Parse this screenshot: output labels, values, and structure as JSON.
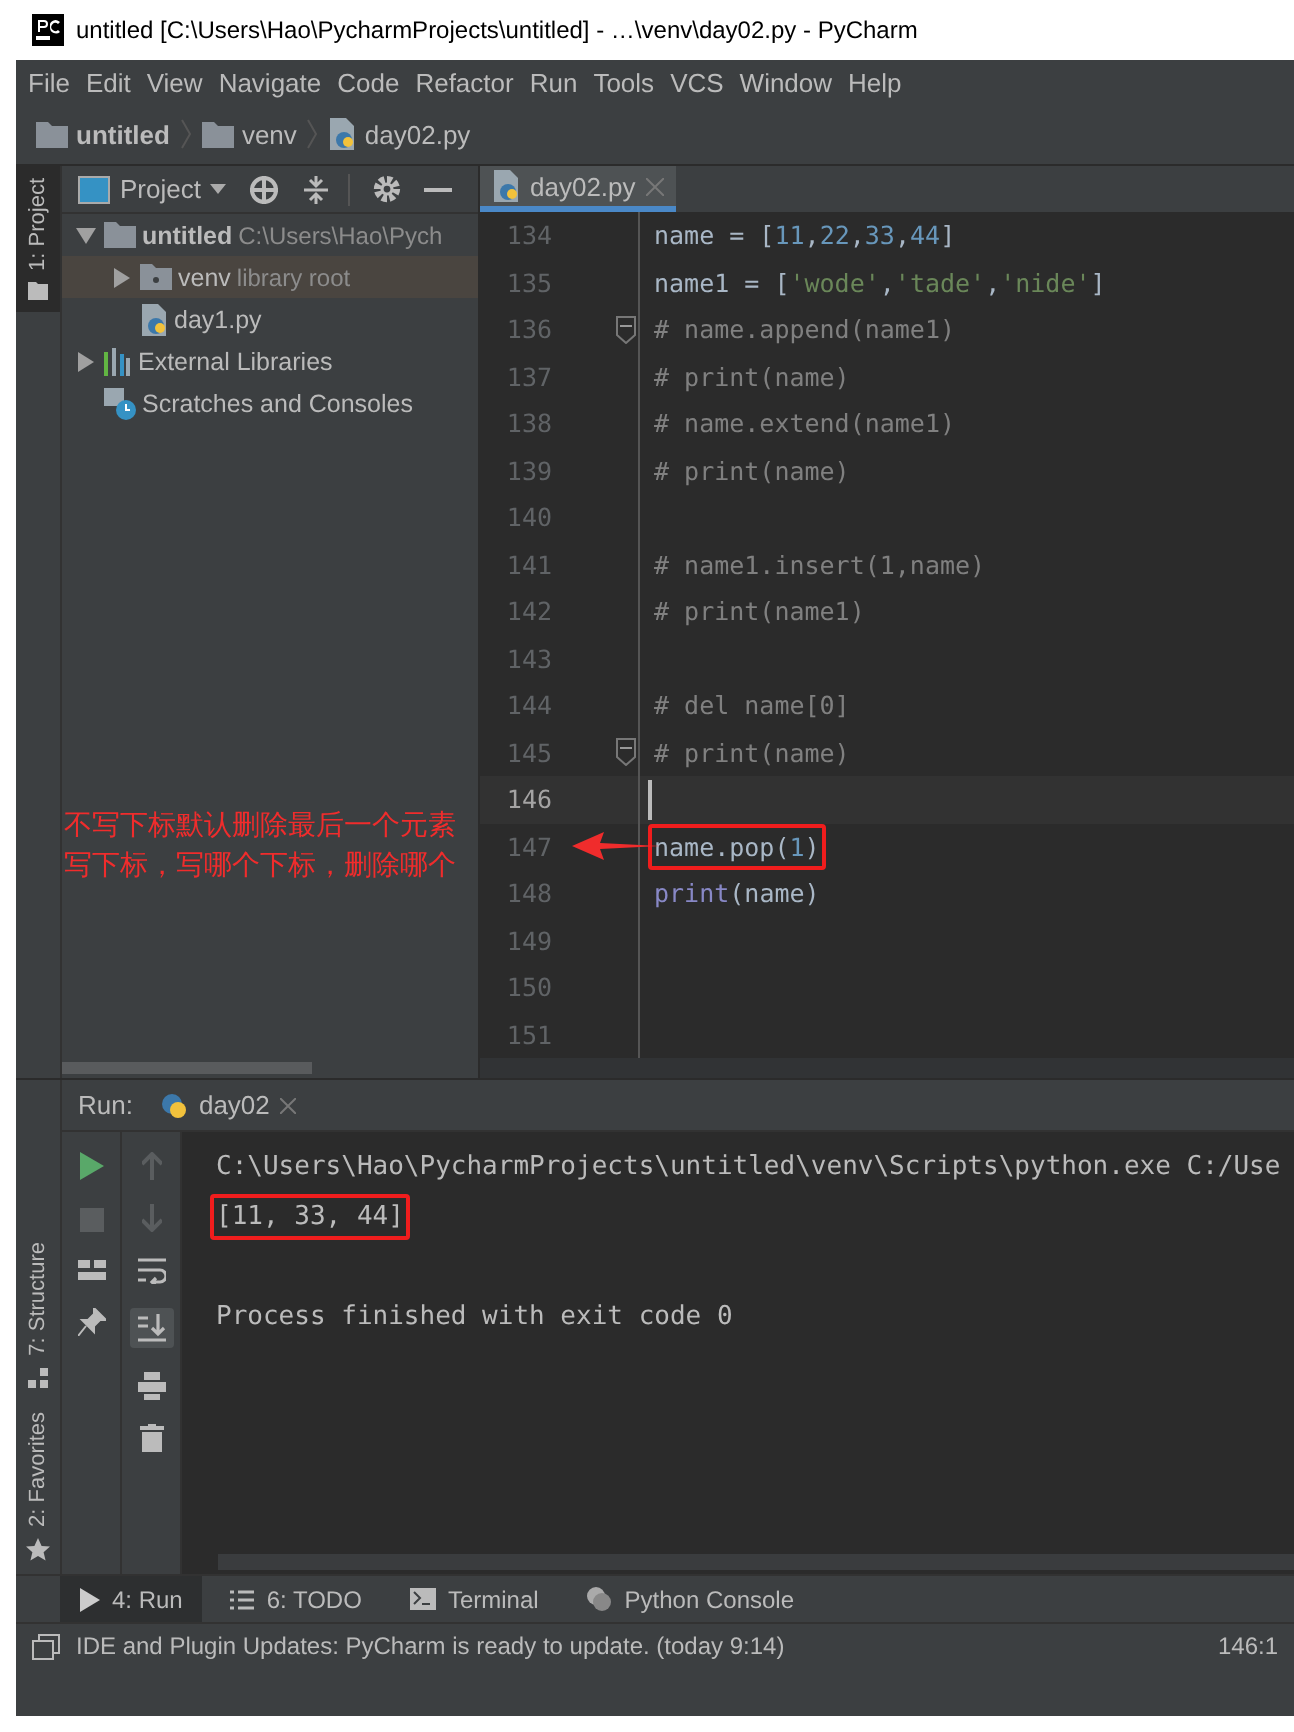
{
  "window": {
    "title": "untitled [C:\\Users\\Hao\\PycharmProjects\\untitled] - …\\venv\\day02.py - PyCharm"
  },
  "menu": [
    "File",
    "Edit",
    "View",
    "Navigate",
    "Code",
    "Refactor",
    "Run",
    "Tools",
    "VCS",
    "Window",
    "Help"
  ],
  "breadcrumbs": [
    {
      "label": "untitled",
      "kind": "folder"
    },
    {
      "label": "venv",
      "kind": "folder"
    },
    {
      "label": "day02.py",
      "kind": "python"
    }
  ],
  "stripe_top": [
    {
      "label": "1: Project",
      "selected": true
    }
  ],
  "stripe_bottom": [
    {
      "label": "7: Structure",
      "kind": "structure"
    },
    {
      "label": "2: Favorites",
      "kind": "star"
    }
  ],
  "project_panel": {
    "title": "Project",
    "tree": [
      {
        "label": "untitled",
        "hint": "C:\\Users\\Hao\\Pych",
        "kind": "folder",
        "expanded": true,
        "selected": false,
        "children": [
          {
            "label": "venv",
            "hint": "library root",
            "kind": "folder",
            "expanded": false,
            "selected": true
          },
          {
            "label": "day1.py",
            "kind": "python",
            "selected": false
          }
        ]
      },
      {
        "label": "External Libraries",
        "kind": "library",
        "expanded": false,
        "selected": false
      },
      {
        "label": "Scratches and Consoles",
        "kind": "scratch",
        "selected": false
      }
    ]
  },
  "editor": {
    "tab": {
      "label": "day02.py",
      "selected": true
    },
    "lines": [
      {
        "number": "134",
        "tokens": [
          {
            "t": "name = [",
            "kind": "plain"
          },
          {
            "t": "11",
            "kind": "number"
          },
          {
            "t": ",",
            "kind": "plain"
          },
          {
            "t": "22",
            "kind": "number"
          },
          {
            "t": ",",
            "kind": "plain"
          },
          {
            "t": "33",
            "kind": "number"
          },
          {
            "t": ",",
            "kind": "plain"
          },
          {
            "t": "44",
            "kind": "number"
          },
          {
            "t": "]",
            "kind": "plain"
          }
        ]
      },
      {
        "number": "135",
        "tokens": [
          {
            "t": "name1 = [",
            "kind": "plain"
          },
          {
            "t": "'wode'",
            "kind": "string"
          },
          {
            "t": ",",
            "kind": "plain"
          },
          {
            "t": "'tade'",
            "kind": "string"
          },
          {
            "t": ",",
            "kind": "plain"
          },
          {
            "t": "'nide'",
            "kind": "string"
          },
          {
            "t": "]",
            "kind": "plain"
          }
        ]
      },
      {
        "number": "136",
        "fold": true,
        "tokens": [
          {
            "t": "# name.append(name1)",
            "kind": "comment"
          }
        ]
      },
      {
        "number": "137",
        "tokens": [
          {
            "t": "# print(name)",
            "kind": "comment"
          }
        ]
      },
      {
        "number": "138",
        "tokens": [
          {
            "t": "# name.extend(name1)",
            "kind": "comment"
          }
        ]
      },
      {
        "number": "139",
        "tokens": [
          {
            "t": "# print(name)",
            "kind": "comment"
          }
        ]
      },
      {
        "number": "140"
      },
      {
        "number": "141",
        "tokens": [
          {
            "t": "# name1.insert(1,name)",
            "kind": "comment"
          }
        ]
      },
      {
        "number": "142",
        "tokens": [
          {
            "t": "# print(name1)",
            "kind": "comment"
          }
        ]
      },
      {
        "number": "143"
      },
      {
        "number": "144",
        "tokens": [
          {
            "t": "# del name[0]",
            "kind": "comment"
          }
        ]
      },
      {
        "number": "145",
        "fold": true,
        "tokens": [
          {
            "t": "# print(name)",
            "kind": "comment"
          }
        ]
      },
      {
        "number": "146",
        "current": true
      },
      {
        "number": "147",
        "boxed": true,
        "tokens": [
          {
            "t": "name.pop(",
            "kind": "plain"
          },
          {
            "t": "1",
            "kind": "number"
          },
          {
            "t": ")",
            "kind": "plain"
          }
        ]
      },
      {
        "number": "148",
        "tokens": [
          {
            "t": "print",
            "kind": "builtin"
          },
          {
            "t": "(name)",
            "kind": "plain"
          }
        ]
      },
      {
        "number": "149"
      },
      {
        "number": "150"
      },
      {
        "number": "151"
      }
    ],
    "annotation": [
      "不写下标默认删除最后一个元素",
      "写下标，写哪个下标，删除哪个"
    ]
  },
  "run": {
    "label": "Run:",
    "tab": "day02",
    "output": [
      {
        "kind": "text",
        "text": "C:\\Users\\Hao\\PycharmProjects\\untitled\\venv\\Scripts\\python.exe C:/Use",
        "boxed": false
      },
      {
        "kind": "text",
        "text": "[11, 33, 44]",
        "boxed": true
      },
      {
        "kind": "blank"
      },
      {
        "kind": "text",
        "text": "Process finished with exit code 0",
        "boxed": false
      }
    ]
  },
  "bottom_tabs": [
    {
      "label": "4: Run",
      "kind": "run",
      "selected": true
    },
    {
      "label": "6: TODO",
      "kind": "todo",
      "selected": false
    },
    {
      "label": "Terminal",
      "kind": "terminal",
      "selected": false
    },
    {
      "label": "Python Console",
      "kind": "python",
      "selected": false
    }
  ],
  "status": {
    "message": "IDE and Plugin Updates: PyCharm is ready to update. (today 9:14)",
    "position": "146:1"
  }
}
